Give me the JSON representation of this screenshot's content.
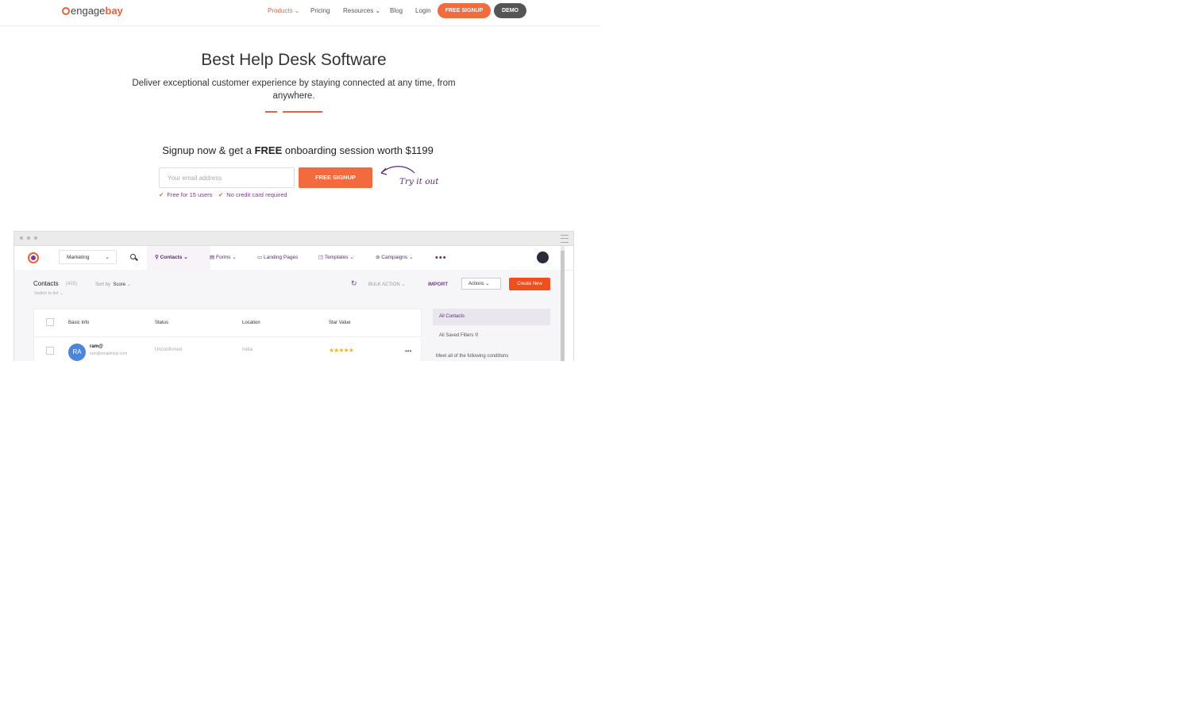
{
  "header": {
    "logo": {
      "part1": "engage",
      "part2": "bay"
    },
    "nav": [
      {
        "label": "Products ⌄",
        "active": true
      },
      {
        "label": "Pricing",
        "active": false
      },
      {
        "label": "Resources ⌄",
        "active": false
      },
      {
        "label": "Blog",
        "active": false
      },
      {
        "label": "Login",
        "active": false
      }
    ],
    "free_signup": "FREE SIGNUP",
    "demo": "DEMO"
  },
  "hero": {
    "title": "Best Help Desk Software",
    "subtitle": "Deliver exceptional customer experience by staying connected at any time, from anywhere.",
    "signup_pre": "Signup now & get a",
    "signup_bold": "FREE",
    "signup_post": "onboarding session worth $1199",
    "email_placeholder": "Your email address",
    "signup_button": "FREE SIGNUP",
    "try_it_out": "Try it out",
    "checks": [
      "Free for 15 users",
      "No credit card required"
    ]
  },
  "app": {
    "module": "Marketing",
    "tabs": [
      {
        "label": "Contacts",
        "icon": "user-icon"
      },
      {
        "label": "Forms",
        "icon": "form-icon"
      },
      {
        "label": "Landing Pages",
        "icon": "monitor-icon"
      },
      {
        "label": "Templates",
        "icon": "template-icon"
      },
      {
        "label": "Campaigns",
        "icon": "campaign-icon"
      }
    ],
    "more": "•••",
    "contacts_title": "Contacts",
    "contacts_count": "(415)",
    "sort_by_label": "Sort by",
    "sort_by_value": "Score",
    "switch_to_list": "Switch to list",
    "bulk_action": "BULK ACTION",
    "import": "IMPORT",
    "actions": "Actions",
    "create_new": "Create New",
    "columns": [
      "Basic Info",
      "Status",
      "Location",
      "Star Value"
    ],
    "row": {
      "initials": "RA",
      "name": "ram@",
      "email": "ram@emailmojo.com",
      "status": "Unconfirmed",
      "location": "India",
      "stars": "★★★★★",
      "more": "•••"
    },
    "sidebar": {
      "all_contacts": "All Contacts",
      "all_saved_filters": "All Saved Filters",
      "meet_condition": "Meet all of the following conditions"
    }
  },
  "colors": {
    "accent": "#f26a3d",
    "purple": "#5a2a77",
    "dark_button": "#555555"
  }
}
